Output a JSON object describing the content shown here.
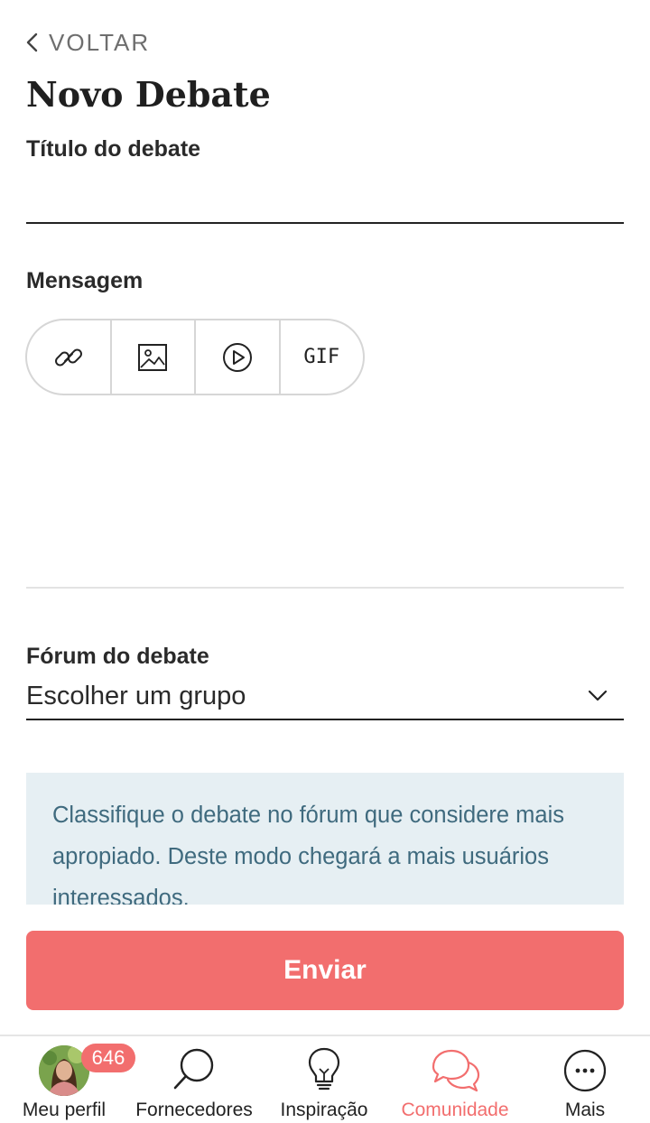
{
  "header": {
    "back_label": "VOLTAR",
    "title": "Novo Debate"
  },
  "form": {
    "title_label": "Título do debate",
    "title_value": "",
    "message_label": "Mensagem",
    "toolbar": [
      {
        "icon": "link-icon"
      },
      {
        "icon": "image-icon"
      },
      {
        "icon": "video-icon"
      },
      {
        "icon": "gif-icon",
        "text": "GIF"
      }
    ],
    "message_value": "",
    "forum_label": "Fórum do debate",
    "forum_value": "Escolher um grupo",
    "info_text": "Classifique o debate no fórum que considere mais apropiado. Deste modo chegará a mais usuários interessados.",
    "submit_label": "Enviar"
  },
  "tabbar": {
    "items": [
      {
        "label": "Meu perfil",
        "icon": "avatar",
        "badge": "646"
      },
      {
        "label": "Fornecedores",
        "icon": "search-icon"
      },
      {
        "label": "Inspiração",
        "icon": "lightbulb-icon"
      },
      {
        "label": "Comunidade",
        "icon": "chat-bubbles-icon",
        "active": true
      },
      {
        "label": "Mais",
        "icon": "more-icon"
      }
    ]
  },
  "colors": {
    "accent": "#f26e6e",
    "info_background": "#e6eff3",
    "info_text": "#3f6a7e",
    "text": "#222222"
  }
}
